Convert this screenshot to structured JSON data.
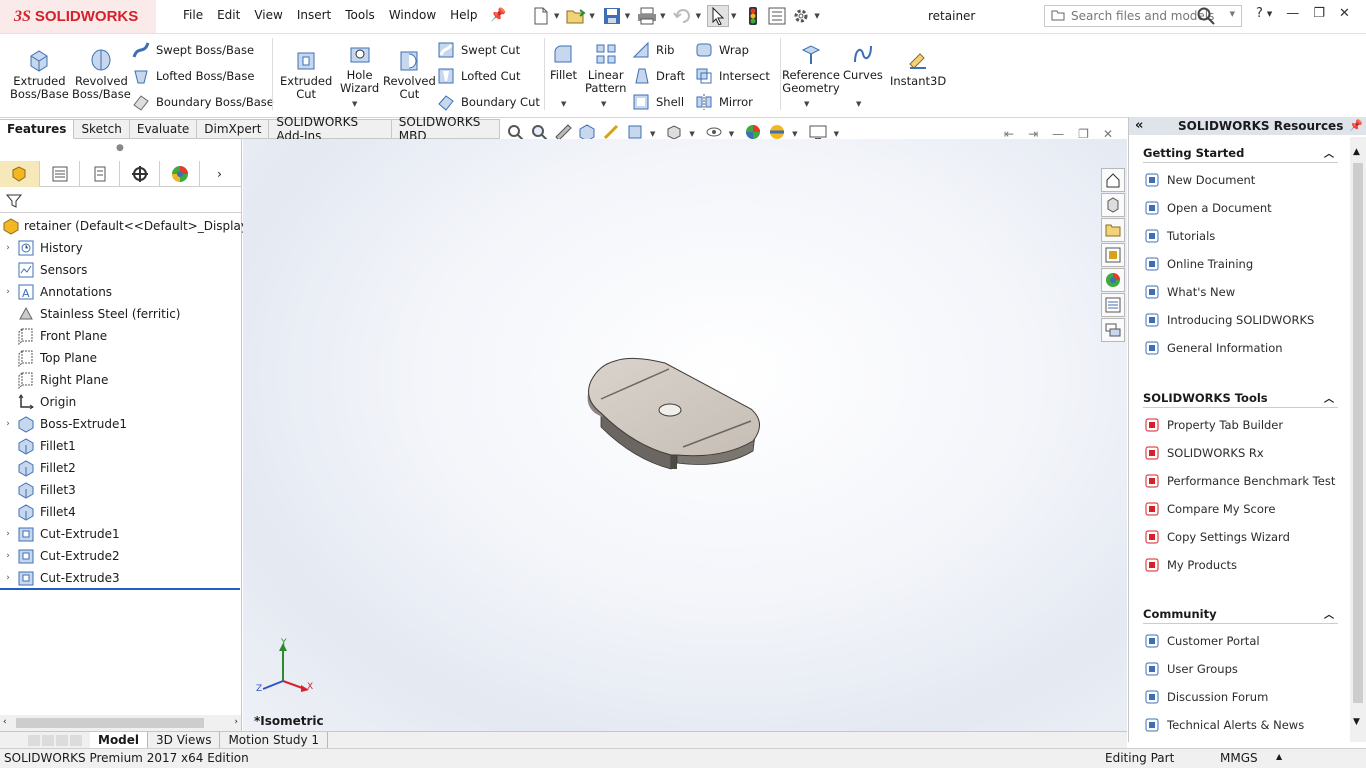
{
  "app": {
    "brand": "SOLIDWORKS",
    "document_title": "retainer",
    "menu": [
      "File",
      "Edit",
      "View",
      "Insert",
      "Tools",
      "Window",
      "Help"
    ],
    "search_placeholder": "Search files and models"
  },
  "ribbon": {
    "extruded_boss": [
      "Extruded",
      "Boss/Base"
    ],
    "revolved_boss": [
      "Revolved",
      "Boss/Base"
    ],
    "swept_boss": "Swept Boss/Base",
    "lofted_boss": "Lofted Boss/Base",
    "boundary_boss": "Boundary Boss/Base",
    "extruded_cut": [
      "Extruded",
      "Cut"
    ],
    "hole_wizard": [
      "Hole",
      "Wizard"
    ],
    "revolved_cut": [
      "Revolved",
      "Cut"
    ],
    "swept_cut": "Swept Cut",
    "lofted_cut": "Lofted Cut",
    "boundary_cut": "Boundary Cut",
    "fillet": "Fillet",
    "linear_pattern": [
      "Linear",
      "Pattern"
    ],
    "rib": "Rib",
    "draft": "Draft",
    "shell": "Shell",
    "wrap": "Wrap",
    "intersect": "Intersect",
    "mirror": "Mirror",
    "reference_geometry": [
      "Reference",
      "Geometry"
    ],
    "curves": "Curves",
    "instant3d": "Instant3D"
  },
  "command_tabs": [
    "Features",
    "Sketch",
    "Evaluate",
    "DimXpert",
    "SOLIDWORKS Add-Ins",
    "SOLIDWORKS MBD"
  ],
  "feature_tree": {
    "root": "retainer  (Default<<Default>_Display Stat",
    "items": [
      {
        "label": "History",
        "expandable": true,
        "icon": "history-icon"
      },
      {
        "label": "Sensors",
        "expandable": false,
        "icon": "sensors-icon"
      },
      {
        "label": "Annotations",
        "expandable": true,
        "icon": "annotations-icon"
      },
      {
        "label": "Stainless Steel (ferritic)",
        "expandable": false,
        "icon": "material-icon"
      },
      {
        "label": "Front Plane",
        "expandable": false,
        "icon": "plane-icon"
      },
      {
        "label": "Top Plane",
        "expandable": false,
        "icon": "plane-icon"
      },
      {
        "label": "Right Plane",
        "expandable": false,
        "icon": "plane-icon"
      },
      {
        "label": "Origin",
        "expandable": false,
        "icon": "origin-icon"
      },
      {
        "label": "Boss-Extrude1",
        "expandable": true,
        "icon": "boss-extrude-icon"
      },
      {
        "label": "Fillet1",
        "expandable": false,
        "icon": "fillet-icon"
      },
      {
        "label": "Fillet2",
        "expandable": false,
        "icon": "fillet-icon"
      },
      {
        "label": "Fillet3",
        "expandable": false,
        "icon": "fillet-icon"
      },
      {
        "label": "Fillet4",
        "expandable": false,
        "icon": "fillet-icon"
      },
      {
        "label": "Cut-Extrude1",
        "expandable": true,
        "icon": "cut-extrude-icon"
      },
      {
        "label": "Cut-Extrude2",
        "expandable": true,
        "icon": "cut-extrude-icon"
      },
      {
        "label": "Cut-Extrude3",
        "expandable": true,
        "icon": "cut-extrude-icon"
      }
    ]
  },
  "viewport": {
    "view_label": "*Isometric",
    "triad": {
      "x": "X",
      "y": "Y",
      "z": "Z"
    }
  },
  "task_pane": {
    "title": "SOLIDWORKS Resources",
    "sections": [
      {
        "title": "Getting Started",
        "items": [
          "New Document",
          "Open a Document",
          "Tutorials",
          "Online Training",
          "What's New",
          "Introducing SOLIDWORKS",
          "General Information"
        ]
      },
      {
        "title": "SOLIDWORKS Tools",
        "items": [
          "Property Tab Builder",
          "SOLIDWORKS Rx",
          "Performance Benchmark Test",
          "Compare My Score",
          "Copy Settings Wizard",
          "My Products"
        ]
      },
      {
        "title": "Community",
        "items": [
          "Customer Portal",
          "User Groups",
          "Discussion Forum",
          "Technical Alerts & News"
        ]
      }
    ]
  },
  "bottom_tabs": [
    "Model",
    "3D Views",
    "Motion Study 1"
  ],
  "status": {
    "edition": "SOLIDWORKS Premium 2017 x64 Edition",
    "mode": "Editing Part",
    "units": "MMGS"
  },
  "colors": {
    "accent": "#d6202a",
    "blue": "#1f5fbf",
    "selected_tab": "#f6e8b8"
  }
}
